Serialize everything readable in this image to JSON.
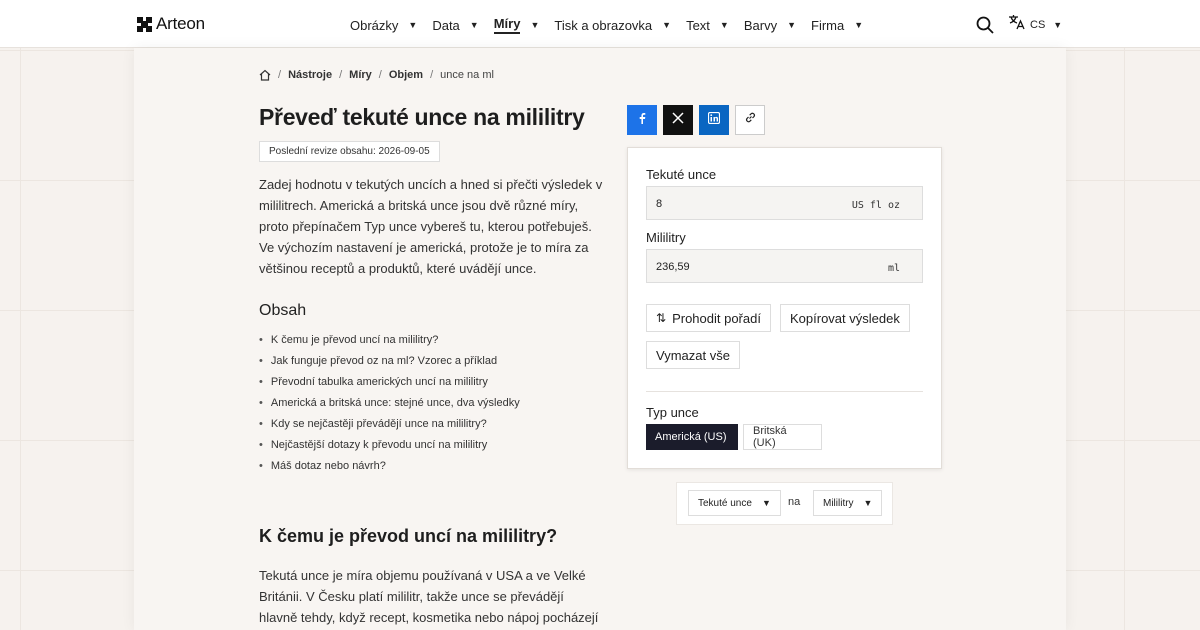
{
  "brand": {
    "name": "Arteon"
  },
  "nav": {
    "items": [
      {
        "label": "Obrázky"
      },
      {
        "label": "Data"
      },
      {
        "label": "Míry"
      },
      {
        "label": "Tisk a obrazovka"
      },
      {
        "label": "Text"
      },
      {
        "label": "Barvy"
      },
      {
        "label": "Firma"
      }
    ],
    "active": "Míry",
    "language": "CS"
  },
  "breadcrumb": {
    "items": [
      "Nástroje",
      "Míry",
      "Objem"
    ],
    "current": "unce na ml"
  },
  "article": {
    "title": "Převeď tekuté unce na mililitry",
    "revision": "Poslední revize obsahu: 2026-09-05",
    "intro": "Zadej hodnotu v tekutých uncích a hned si přečti výsledek v mililitrech. Americká a britská unce jsou dvě různé míry, proto přepínačem Typ unce vybereš tu, kterou potřebuješ. Ve výchozím nastavení je americká, protože je to míra za většinou receptů a produktů, které uvádějí unce.",
    "toc_title": "Obsah",
    "toc": [
      "K čemu je převod uncí na mililitry?",
      "Jak funguje převod oz na ml? Vzorec a příklad",
      "Převodní tabulka amerických uncí na mililitry",
      "Americká a britská unce: stejné unce, dva výsledky",
      "Kdy se nejčastěji převádějí unce na mililitry?",
      "Nejčastější dotazy k převodu uncí na mililitry",
      "Máš dotaz nebo návrh?"
    ],
    "section_title": "K čemu je převod uncí na mililitry?",
    "section_body": "Tekutá unce je míra objemu používaná v USA a ve Velké Británii. V Česku platí mililitr, takže unce se převádějí hlavně tehdy, když recept, kosmetika nebo nápoj pocházejí"
  },
  "share": {
    "icons": [
      "facebook-icon",
      "x-icon",
      "linkedin-icon",
      "link-icon"
    ],
    "colors": {
      "facebook": "#1d73e8",
      "x": "#111111",
      "linkedin": "#0a66c2"
    }
  },
  "converter": {
    "from_label": "Tekuté unce",
    "from_value": "8",
    "from_unit": "US fl oz",
    "to_label": "Mililitry",
    "to_value": "236,59",
    "to_unit": "ml",
    "swap_label": "Prohodit pořadí",
    "copy_label": "Kopírovat výsledek",
    "clear_label": "Vymazat vše",
    "type_label": "Typ unce",
    "type_options": [
      "Americká (US)",
      "Britská (UK)"
    ],
    "type_selected": "Americká (US)"
  },
  "unit_selector": {
    "from": "Tekuté unce",
    "connector": "na",
    "to": "Mililitry"
  },
  "colors": {
    "accent_dark": "#1b1c2b",
    "page_bg": "#f6f2ee"
  }
}
